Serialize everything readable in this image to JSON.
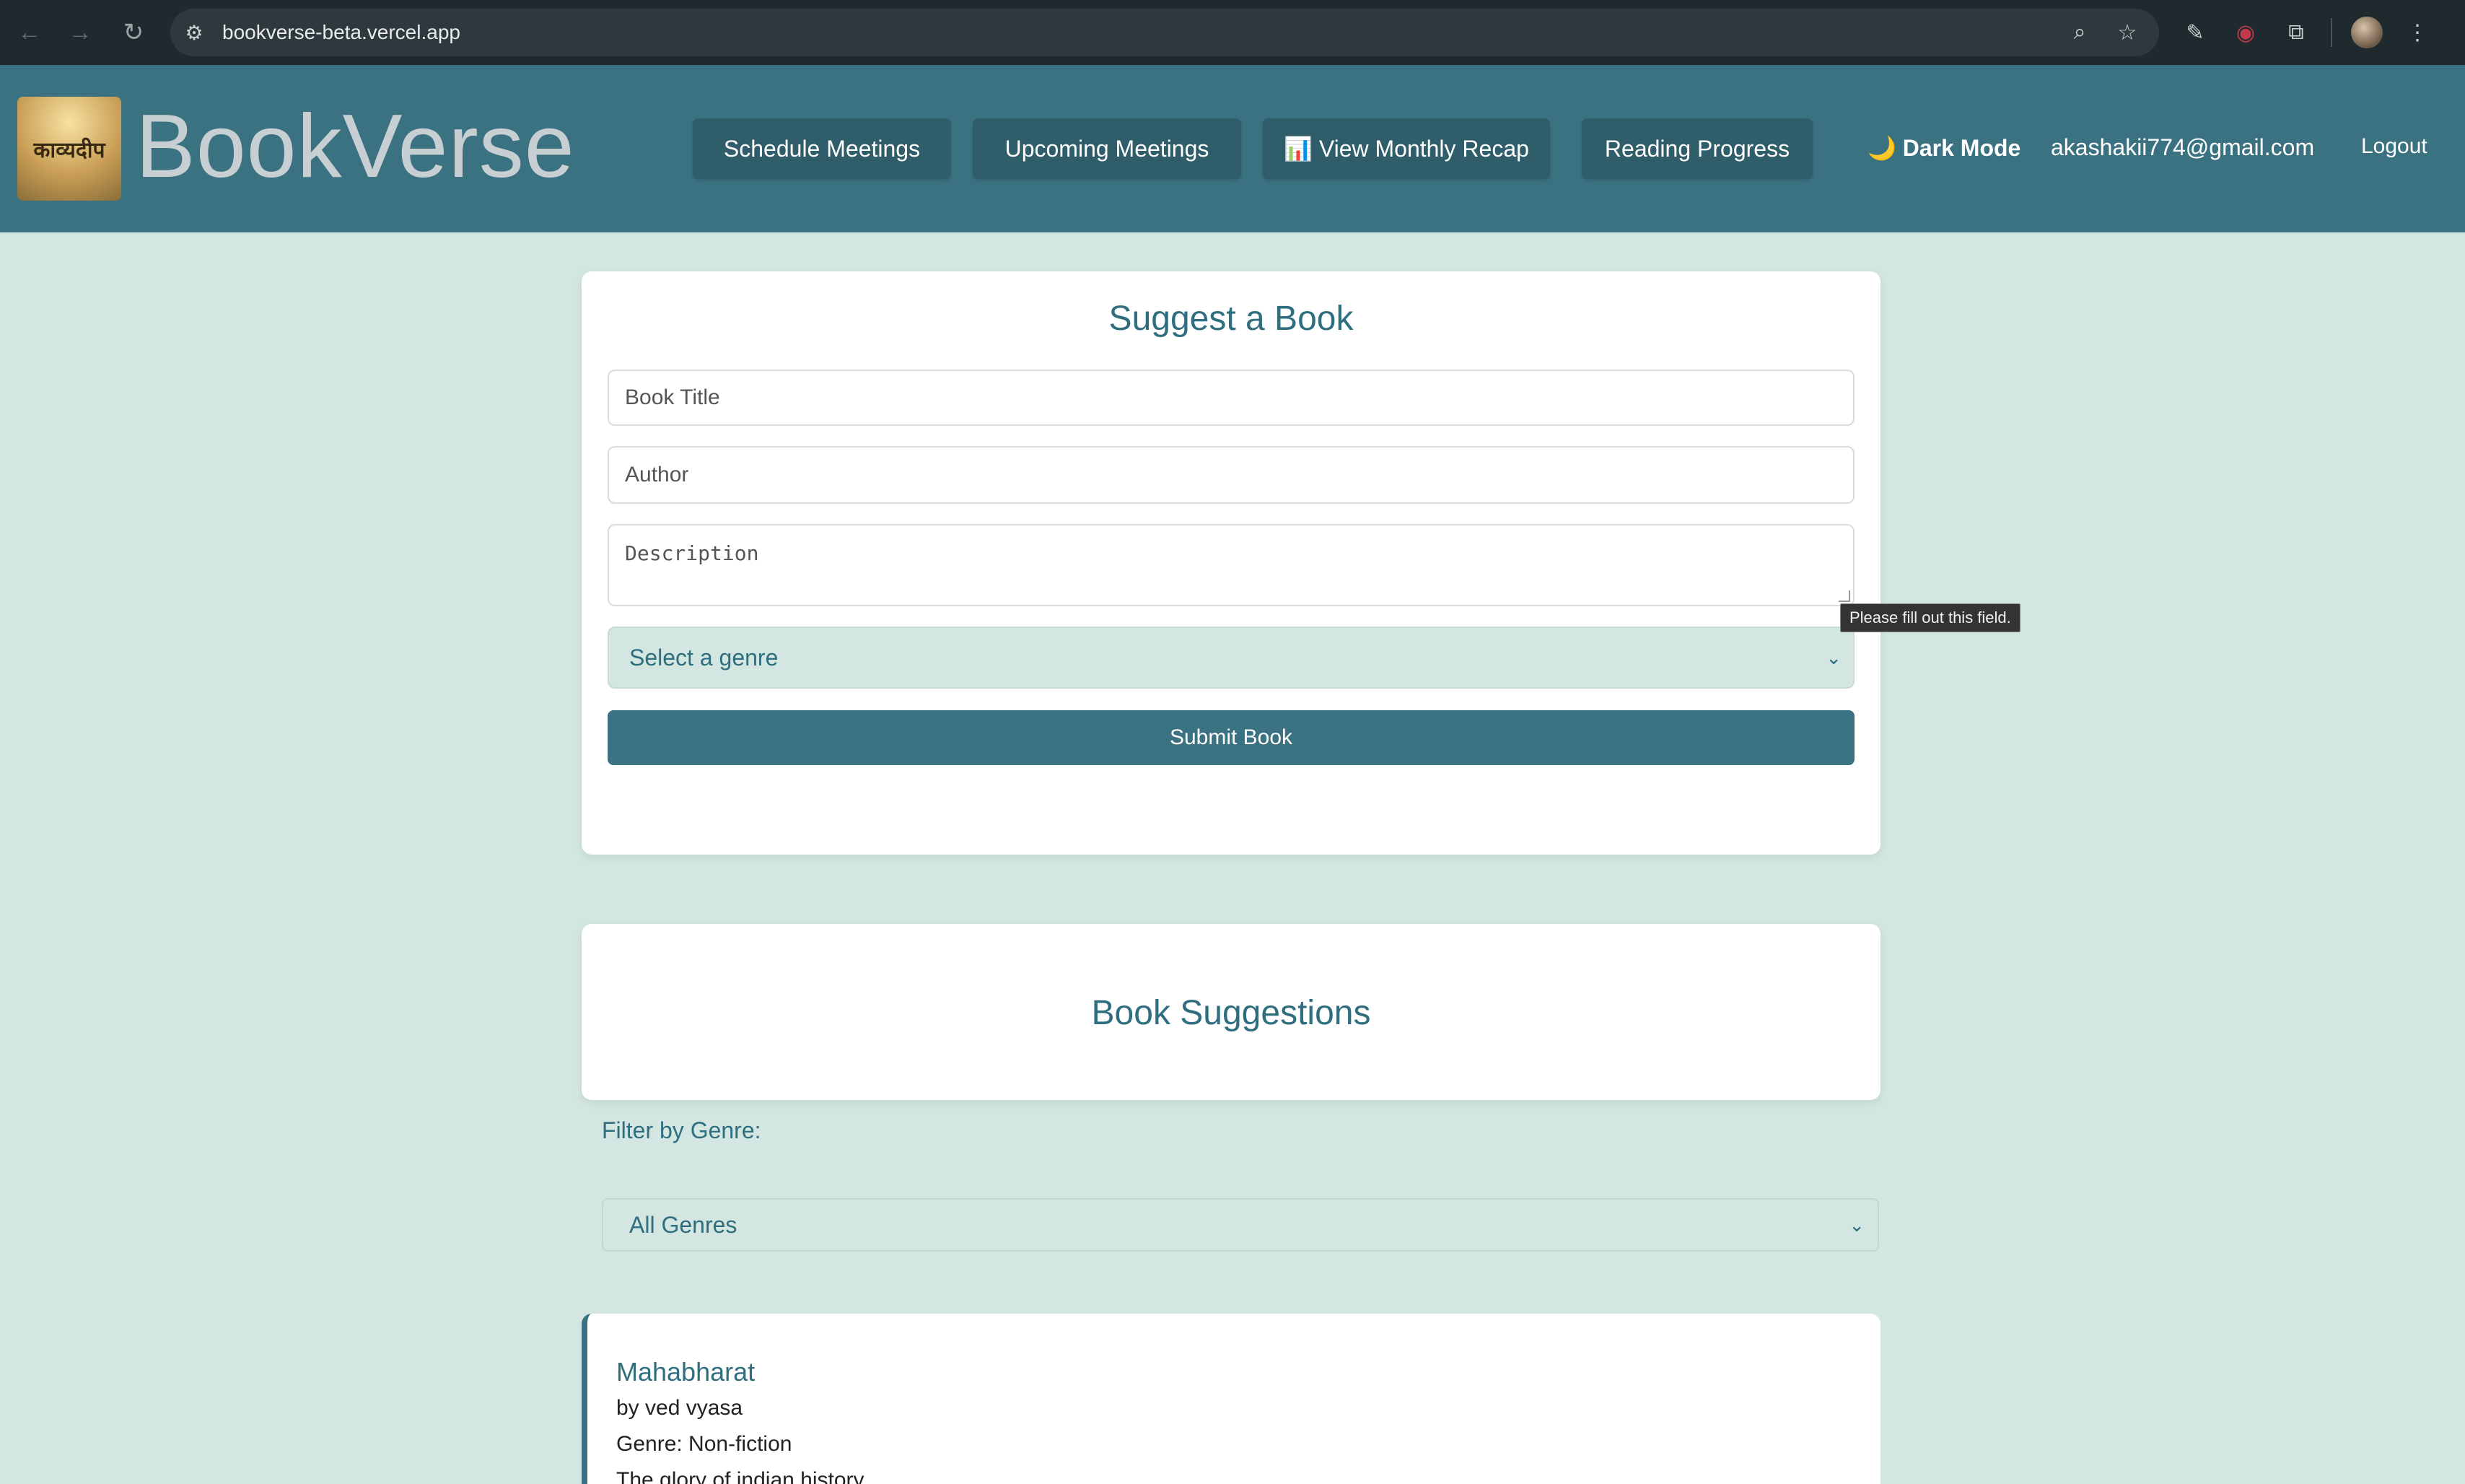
{
  "browser": {
    "url": "bookverse-beta.vercel.app",
    "icons": [
      "back-icon",
      "forward-icon",
      "reload-icon",
      "site-info-icon",
      "zoom-icon",
      "star-icon",
      "pen-extension-icon",
      "record-extension-icon",
      "puzzle-extensions-icon",
      "profile-avatar",
      "menu-kebab-icon"
    ]
  },
  "header": {
    "logo_text": "काव्यदीप",
    "brand": "BookVerse",
    "nav": {
      "schedule": "Schedule Meetings",
      "upcoming": "Upcoming Meetings",
      "recap": "📊 View Monthly Recap",
      "progress": "Reading Progress"
    },
    "dark_mode": "🌙 Dark Mode",
    "email": "akashakii774@gmail.com",
    "logout": "Logout"
  },
  "suggest_form": {
    "title": "Suggest a Book",
    "book_title_placeholder": "Book Title",
    "author_placeholder": "Author",
    "description_placeholder": "Description",
    "genre_select": "Select a genre",
    "submit": "Submit Book",
    "validation_tooltip": "Please fill out this field."
  },
  "suggestions": {
    "title": "Book Suggestions",
    "filter_label": "Filter by Genre:",
    "filter_value": "All Genres",
    "books": [
      {
        "title": "Mahabharat",
        "author": "by ved vyasa",
        "genre": "Genre: Non-fiction",
        "description": "The glory of indian history"
      }
    ]
  },
  "colors": {
    "header_bg": "#3b7281",
    "page_bg": "#d3e6e2",
    "accent_text": "#2f6e7e"
  }
}
